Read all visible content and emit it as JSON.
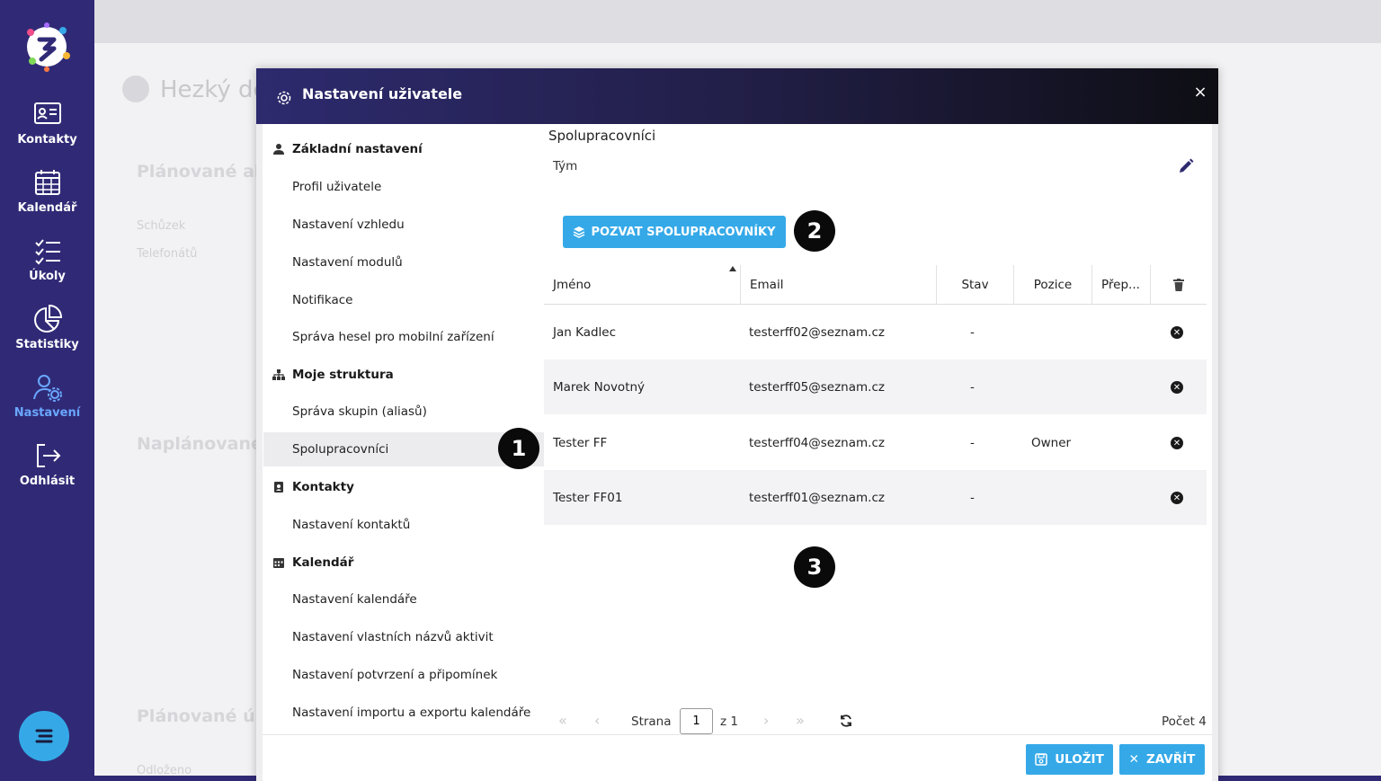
{
  "sidebar": {
    "items": [
      {
        "label": "Kontakty",
        "icon": "contact-card-icon"
      },
      {
        "label": "Kalendář",
        "icon": "calendar-icon"
      },
      {
        "label": "Úkoly",
        "icon": "checklist-icon"
      },
      {
        "label": "Statistiky",
        "icon": "pie-chart-icon"
      },
      {
        "label": "Nastavení",
        "icon": "user-settings-icon"
      },
      {
        "label": "Odhlásit",
        "icon": "logout-icon"
      }
    ],
    "active": "Nastavení",
    "active_color": "#6aa7ff",
    "bg_color": "#302a76"
  },
  "background": {
    "greeting": "Hezký de",
    "card1_title": "Plánované ak",
    "card1_line1": "Schůzek",
    "card1_line2": "Telefonátů",
    "card2_title": "Naplánované",
    "card3_title": "Plánované úk",
    "card3_line1": "Odloženo"
  },
  "modal": {
    "title": "Nastavení uživatele",
    "close": "×",
    "menu": {
      "section_basic": "Základní nastavení",
      "profile": "Profil uživatele",
      "appearance": "Nastavení vzhledu",
      "modules": "Nastavení modulů",
      "notifications": "Notifikace",
      "mobile_passwords": "Správa hesel pro mobilní zařízení",
      "section_structure": "Moje struktura",
      "groups": "Správa skupin (aliasů)",
      "collaborators": "Spolupracovníci",
      "section_contacts": "Kontakty",
      "contact_settings": "Nastavení kontaktů",
      "section_calendar": "Kalendář",
      "calendar_settings": "Nastavení kalendáře",
      "activity_names": "Nastavení vlastních názvů aktivit",
      "confirmations": "Nastavení potvrzení a připomínek",
      "import_export": "Nastavení importu a exportu kalendáře"
    },
    "content": {
      "heading": "Spolupracovníci",
      "team_label": "Tým",
      "invite_button": "POZVAT SPOLUPRACOVNÍKY",
      "columns": {
        "name": "Jméno",
        "email": "Email",
        "status": "Stav",
        "position": "Pozice",
        "switch": "Přep..."
      },
      "rows": [
        {
          "name": "Jan Kadlec",
          "email": "testerff02@seznam.cz",
          "status": "-",
          "position": ""
        },
        {
          "name": "Marek Novotný",
          "email": "testerff05@seznam.cz",
          "status": "-",
          "position": ""
        },
        {
          "name": "Tester FF",
          "email": "testerff04@seznam.cz",
          "status": "-",
          "position": "Owner"
        },
        {
          "name": "Tester FF01",
          "email": "testerff01@seznam.cz",
          "status": "-",
          "position": ""
        }
      ],
      "pager": {
        "page_label": "Strana",
        "page_value": "1",
        "of_label": "z 1",
        "count_label": "Počet 4"
      }
    },
    "footer": {
      "save": "ULOŽIT",
      "close": "ZAVŘÍT"
    },
    "badges": [
      "1",
      "2",
      "3"
    ]
  },
  "accent_color": "#35a9e8"
}
